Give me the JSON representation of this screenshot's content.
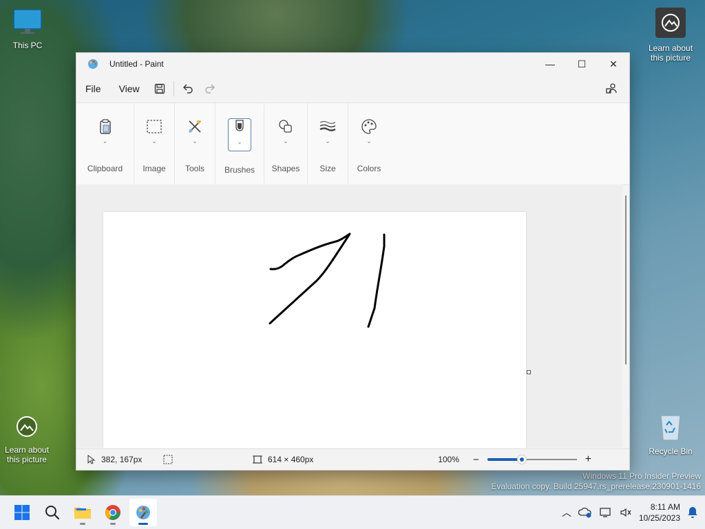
{
  "desktop": {
    "icons": [
      {
        "label": "This PC"
      },
      {
        "label": "Learn about this picture"
      },
      {
        "label": "Learn about this picture"
      },
      {
        "label": "Recycle Bin"
      }
    ],
    "watermark": {
      "line1": "Windows 11 Pro Insider Preview",
      "line2": "Evaluation copy. Build 25947.rs_prerelease.230901-1416"
    }
  },
  "window": {
    "title": "Untitled - Paint",
    "controls": {
      "minimize": "—",
      "maximize": "☐",
      "close": "✕"
    },
    "menu": {
      "file": "File",
      "view": "View"
    },
    "ribbon": {
      "groups": [
        {
          "label": "Clipboard",
          "icon": "clipboard-icon"
        },
        {
          "label": "Image",
          "icon": "selection-icon"
        },
        {
          "label": "Tools",
          "icon": "tools-icon"
        },
        {
          "label": "Brushes",
          "icon": "brush-icon",
          "active": true
        },
        {
          "label": "Shapes",
          "icon": "shapes-icon"
        },
        {
          "label": "Size",
          "icon": "size-icon"
        },
        {
          "label": "Colors",
          "icon": "palette-icon"
        }
      ]
    },
    "status": {
      "cursor_position": "382, 167px",
      "canvas_size": "614 × 460px",
      "zoom": "100%",
      "zoom_level": 0.38
    }
  },
  "taskbar": {
    "apps": [
      "start",
      "search",
      "file-explorer",
      "chrome",
      "paint"
    ],
    "active_app": "paint",
    "clock": {
      "time": "8:11 AM",
      "date": "10/25/2023"
    }
  },
  "colors": {
    "accent": "#1a5fb4",
    "window_bg": "#f3f3f3"
  }
}
